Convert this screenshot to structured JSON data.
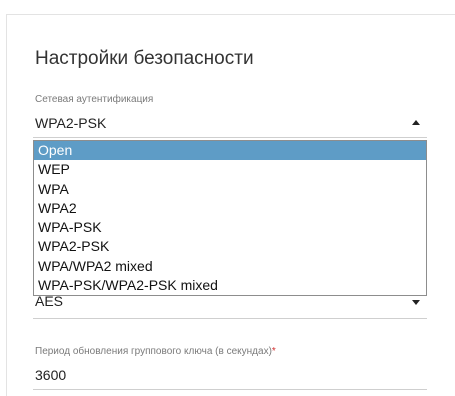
{
  "section": {
    "title": "Настройки безопасности"
  },
  "auth": {
    "label": "Сетевая аутентификация",
    "value": "WPA2-PSK",
    "options": [
      "Open",
      "WEP",
      "WPA",
      "WPA2",
      "WPA-PSK",
      "WPA2-PSK",
      "WPA/WPA2 mixed",
      "WPA-PSK/WPA2-PSK mixed"
    ],
    "highlighted_option": "Open"
  },
  "encryption": {
    "value": "AES"
  },
  "group_key": {
    "label": "Период обновления группового ключа (в секундах)",
    "required_mark": "*",
    "value": "3600"
  },
  "colors": {
    "highlight": "#5e9cc6",
    "required": "#d32f2f"
  }
}
